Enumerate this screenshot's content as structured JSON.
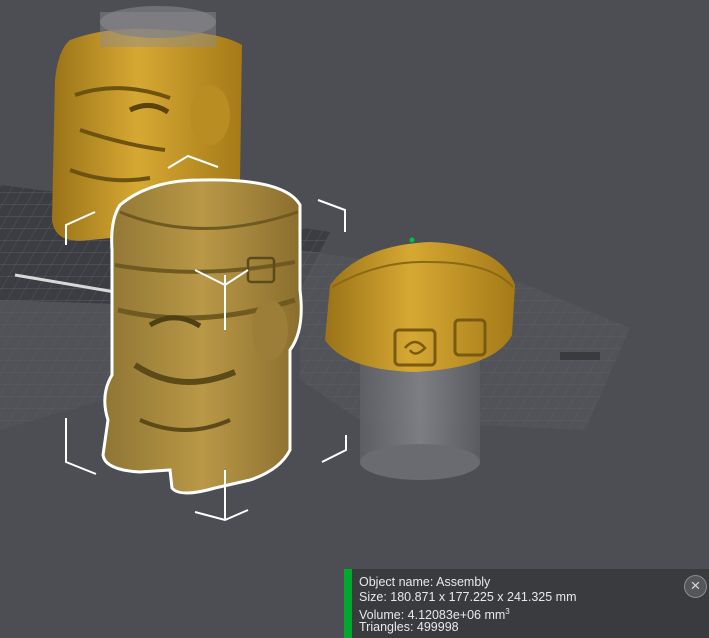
{
  "scene": {
    "colors": {
      "background": "#4d4e53",
      "plate": "#3c3d42",
      "grid": "#6e7076",
      "model": "#c99a2a",
      "model_shade": "#8f6a12",
      "selected_model": "#a8893f",
      "selection_outline": "#ffffff",
      "ghost_part": "#7a7b80"
    },
    "objects": [
      {
        "name": "tiki-statue-back"
      },
      {
        "name": "tiki-statue-selected",
        "selected": true
      },
      {
        "name": "tiki-lid-part"
      }
    ]
  },
  "info": {
    "object_name": "Object name: Assembly",
    "size": "Size: 180.871 x 177.225 x 241.325 mm",
    "volume_prefix": "Volume: 4.12083e+06 mm",
    "volume_sup": "3",
    "triangles": "Triangles: 499998",
    "accent_color": "#00a82e",
    "close_icon": "close-icon"
  }
}
